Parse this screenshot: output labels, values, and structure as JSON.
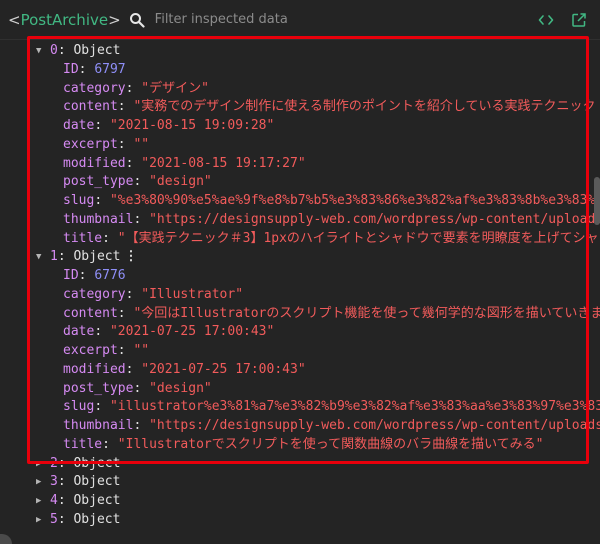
{
  "header": {
    "component_open": "<",
    "component_name": "PostArchive",
    "component_close": ">",
    "search_placeholder": "Filter inspected data",
    "search_value": ""
  },
  "tree": {
    "objects": [
      {
        "index": "0",
        "label": "Object",
        "expanded": true,
        "props": [
          {
            "key": "ID",
            "value": "6797",
            "type": "number"
          },
          {
            "key": "category",
            "value": "\"デザイン\"",
            "type": "string"
          },
          {
            "key": "content",
            "value": "\"実務でのデザイン制作に使える制作のポイントを紹介している実践テクニック",
            "type": "string"
          },
          {
            "key": "date",
            "value": "\"2021-08-15 19:09:28\"",
            "type": "string"
          },
          {
            "key": "excerpt",
            "value": "\"\"",
            "type": "string"
          },
          {
            "key": "modified",
            "value": "\"2021-08-15 19:17:27\"",
            "type": "string"
          },
          {
            "key": "post_type",
            "value": "\"design\"",
            "type": "string"
          },
          {
            "key": "slug",
            "value": "\"%e3%80%90%e5%ae%9f%e8%b7%b5%e3%83%86%e3%82%af%e3%83%8b%e3%83%83",
            "type": "string"
          },
          {
            "key": "thumbnail",
            "value": "\"https://designsupply-web.com/wordpress/wp-content/uploads",
            "type": "string"
          },
          {
            "key": "title",
            "value": "\"【実践テクニック＃3】1pxのハイライトとシャドウで要素を明瞭度を上げてシャ",
            "type": "string"
          }
        ]
      },
      {
        "index": "1",
        "label": "Object",
        "expanded": true,
        "menu": "⋮",
        "props": [
          {
            "key": "ID",
            "value": "6776",
            "type": "number"
          },
          {
            "key": "category",
            "value": "\"Illustrator\"",
            "type": "string"
          },
          {
            "key": "content",
            "value": "\"今回はIllustratorのスクリプト機能を使って幾何学的な図形を描いていきま",
            "type": "string"
          },
          {
            "key": "date",
            "value": "\"2021-07-25 17:00:43\"",
            "type": "string"
          },
          {
            "key": "excerpt",
            "value": "\"\"",
            "type": "string"
          },
          {
            "key": "modified",
            "value": "\"2021-07-25 17:00:43\"",
            "type": "string"
          },
          {
            "key": "post_type",
            "value": "\"design\"",
            "type": "string"
          },
          {
            "key": "slug",
            "value": "\"illustrator%e3%81%a7%e3%82%b9%e3%82%af%e3%83%aa%e3%83%97%e3%83",
            "type": "string"
          },
          {
            "key": "thumbnail",
            "value": "\"https://designsupply-web.com/wordpress/wp-content/uploads",
            "type": "string"
          },
          {
            "key": "title",
            "value": "\"Illustratorでスクリプトを使って関数曲線のバラ曲線を描いてみる\"",
            "type": "string"
          }
        ]
      },
      {
        "index": "2",
        "label": "Object",
        "expanded": false
      },
      {
        "index": "3",
        "label": "Object",
        "expanded": false
      },
      {
        "index": "4",
        "label": "Object",
        "expanded": false
      },
      {
        "index": "5",
        "label": "Object",
        "expanded": false
      }
    ]
  },
  "colors": {
    "accent_green": "#41b883",
    "key_purple": "#d58af2",
    "string_red": "#f25b5b",
    "number_blue": "#8f8ff8",
    "highlight_red": "#e8000b"
  },
  "icons": {
    "search": "search-icon",
    "code": "code-icon",
    "open_in_editor": "open-in-editor-icon"
  }
}
